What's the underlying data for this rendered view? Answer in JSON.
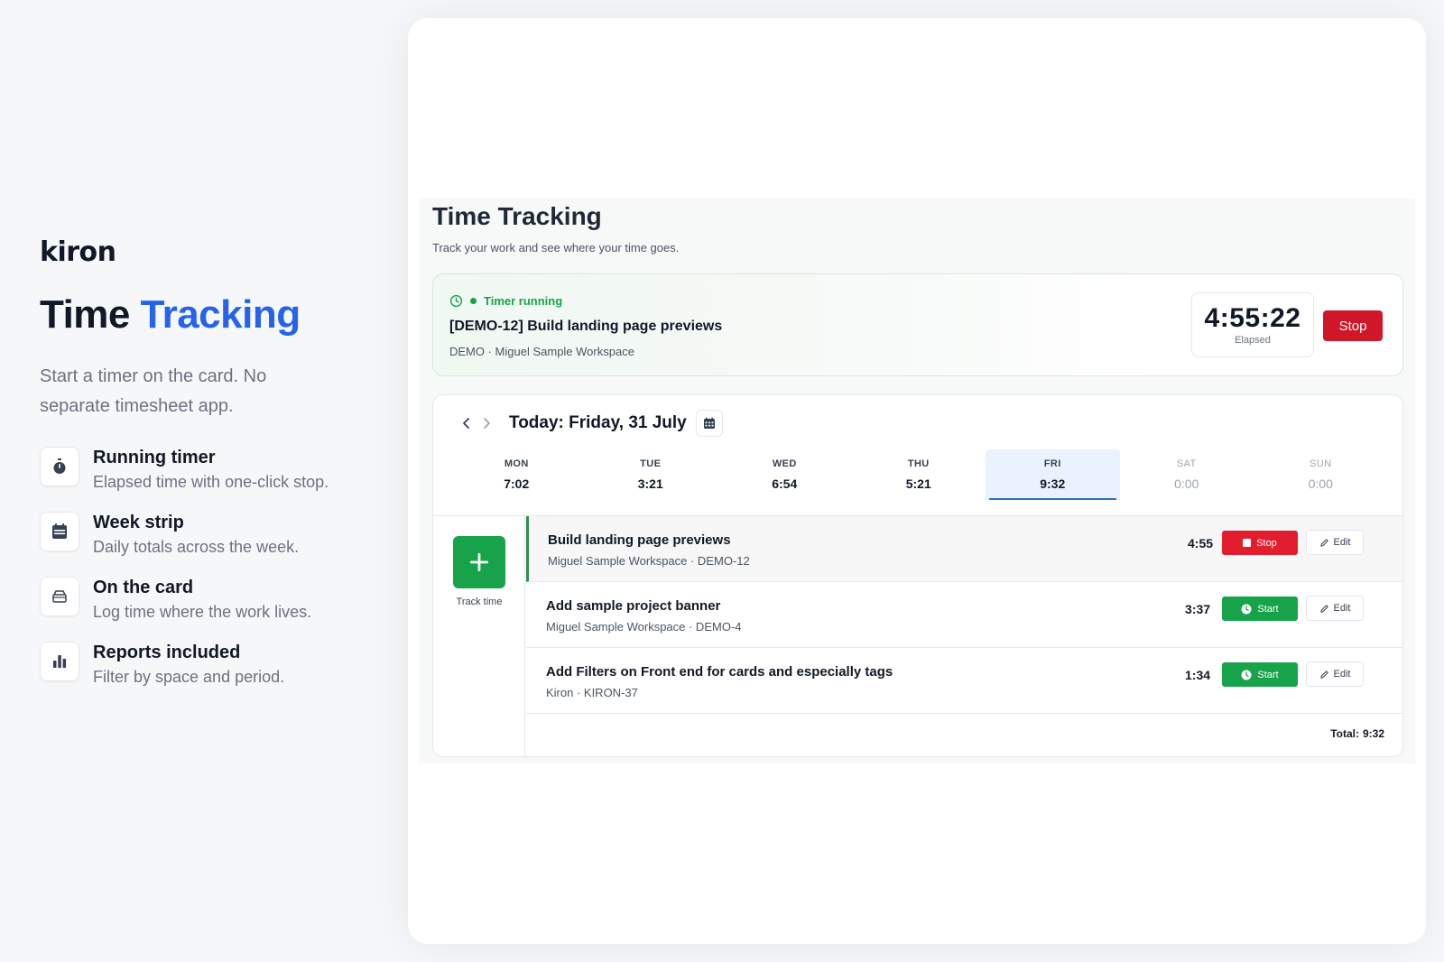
{
  "brand": "kiron",
  "hero": {
    "title_plain": "Time",
    "title_accent": "Tracking",
    "subtitle": "Start a timer on the card. No separate timesheet app."
  },
  "features": [
    {
      "icon": "stopwatch-icon",
      "title": "Running timer",
      "desc": "Elapsed time with one-click stop."
    },
    {
      "icon": "calendar-icon",
      "title": "Week strip",
      "desc": "Daily totals across the week."
    },
    {
      "icon": "card-icon",
      "title": "On the card",
      "desc": "Log time where the work lives."
    },
    {
      "icon": "bar-chart-icon",
      "title": "Reports included",
      "desc": "Filter by space and period."
    }
  ],
  "app": {
    "title": "Time Tracking",
    "subtitle": "Track your work and see where your time goes.",
    "running": {
      "status": "Timer running",
      "task": "[DEMO-12] Build landing page previews",
      "meta": "DEMO · Miguel Sample Workspace",
      "elapsed": "4:55:22",
      "elapsed_label": "Elapsed",
      "stop_label": "Stop"
    },
    "day_title": "Today: Friday, 31 July",
    "week": [
      {
        "name": "MON",
        "value": "7:02"
      },
      {
        "name": "TUE",
        "value": "3:21"
      },
      {
        "name": "WED",
        "value": "6:54"
      },
      {
        "name": "THU",
        "value": "5:21"
      },
      {
        "name": "FRI",
        "value": "9:32"
      },
      {
        "name": "SAT",
        "value": "0:00"
      },
      {
        "name": "SUN",
        "value": "0:00"
      }
    ],
    "active_day": "FRI",
    "track_label": "Track time",
    "entries": [
      {
        "title": "Build landing page previews",
        "meta": "Miguel Sample Workspace · DEMO-12",
        "duration": "4:55",
        "action": "Stop",
        "edit": "Edit"
      },
      {
        "title": "Add sample project banner",
        "meta": "Miguel Sample Workspace · DEMO-4",
        "duration": "3:37",
        "action": "Start",
        "edit": "Edit"
      },
      {
        "title": "Add Filters on Front end for cards and especially tags",
        "meta": "Kiron · KIRON-37",
        "duration": "1:34",
        "action": "Start",
        "edit": "Edit"
      }
    ],
    "total_label": "Total:",
    "total_value": "9:32"
  },
  "colors": {
    "accent": "#2563eb",
    "running_green": "#16a34a",
    "stop_red": "#d0172a",
    "active_day_bg": "#eaf3fd"
  }
}
